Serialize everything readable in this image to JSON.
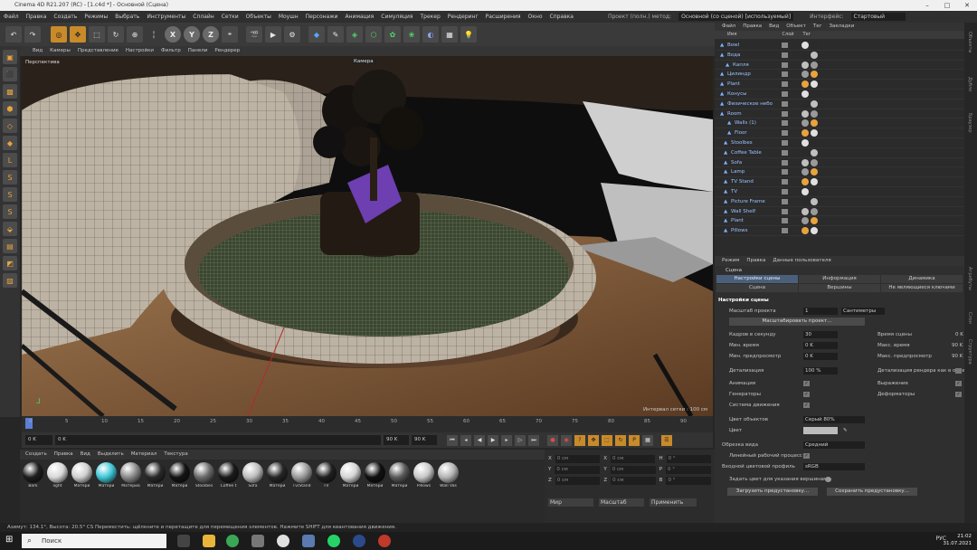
{
  "window": {
    "title": "Cinema 4D R21.207 (RC) - [1.c4d *] - Основной (Сцена)"
  },
  "menu": [
    "Файл",
    "Правка",
    "Создать",
    "Режимы",
    "Выбрать",
    "Инструменты",
    "Сплайн",
    "Сетки",
    "Объекты",
    "Моушн",
    "Персонажи",
    "Анимация",
    "Симуляция",
    "Трекер",
    "Рендеринг",
    "Расширения",
    "Окно",
    "Справка"
  ],
  "layout": {
    "label1": "Проект (полн.) метод:",
    "value1": "Основной (со сценой) [используемый]",
    "label2": "Интерфейс:",
    "value2": "Стартовый"
  },
  "toolbar_icons": [
    "undo-icon",
    "redo-icon",
    "live-select-icon",
    "move-icon",
    "scale-icon",
    "rotate-icon",
    "recent-icon",
    "x-axis-icon",
    "y-axis-icon",
    "z-axis-icon",
    "coord-system-icon",
    "render-view-icon",
    "render-picture-viewer-icon",
    "render-settings-icon",
    "cube-icon",
    "pen-icon",
    "subdivision-icon",
    "array-icon",
    "extrude-icon",
    "environment-icon",
    "deformer-icon",
    "camera-icon",
    "light-icon"
  ],
  "xyz": [
    "X",
    "Y",
    "Z"
  ],
  "viewport": {
    "menu": [
      "Вид",
      "Камеры",
      "Представление",
      "Настройки",
      "Фильтр",
      "Панели",
      "Рендерер"
    ],
    "view_name": "Перспектива",
    "camera": "Камера",
    "grid": "Интервал сетки : 100 см"
  },
  "timeline": {
    "ticks": [
      "0",
      "5",
      "10",
      "15",
      "20",
      "25",
      "30",
      "35",
      "40",
      "45",
      "50",
      "55",
      "60",
      "65",
      "70",
      "75",
      "80",
      "85",
      "90"
    ]
  },
  "playback": {
    "start": "0 K",
    "current": "0 K",
    "end": "90 K",
    "max": "90 K"
  },
  "materials": {
    "menu": [
      "Создать",
      "Правка",
      "Вид",
      "Выделить",
      "Материал",
      "Текстура"
    ],
    "items": [
      {
        "name": "Bark",
        "c": "#1e1e1e"
      },
      {
        "name": "light",
        "c": "#d8d8d8"
      },
      {
        "name": "Матери",
        "c": "#cfcfcf"
      },
      {
        "name": "Матери",
        "c": "#3ec6d6"
      },
      {
        "name": "Материа",
        "c": "#8a8a8a"
      },
      {
        "name": "Матери",
        "c": "#2a2a2a"
      },
      {
        "name": "Матери",
        "c": "#141414"
      },
      {
        "name": "Stoolbes",
        "c": "#6a6a6a"
      },
      {
        "name": "Coffee t",
        "c": "#1a1a1a"
      },
      {
        "name": "Sofa",
        "c": "#bdbdbd"
      },
      {
        "name": "Матери",
        "c": "#262626"
      },
      {
        "name": "Tv/Stand",
        "c": "#9a9a9a"
      },
      {
        "name": "TV",
        "c": "#202020"
      },
      {
        "name": "Матери",
        "c": "#d5d5d5"
      },
      {
        "name": "Матери",
        "c": "#101010"
      },
      {
        "name": "Матери",
        "c": "#5a5a5a"
      },
      {
        "name": "Pillows",
        "c": "#c8c8c8"
      },
      {
        "name": "Wall Vas",
        "c": "#b4b4b4"
      }
    ]
  },
  "coords": {
    "rows": [
      {
        "a": "X",
        "v1": "0 см",
        "b": "X",
        "v2": "0 см",
        "c": "H",
        "v3": "0 °"
      },
      {
        "a": "Y",
        "v1": "0 см",
        "b": "Y",
        "v2": "0 см",
        "c": "P",
        "v3": "0 °"
      },
      {
        "a": "Z",
        "v1": "0 см",
        "b": "Z",
        "v2": "0 см",
        "c": "B",
        "v3": "0 °"
      }
    ],
    "mode1": "Мир",
    "mode2": "Масштаб",
    "apply": "Применить"
  },
  "objects": {
    "menu": [
      "Файл",
      "Правка",
      "Вид",
      "Объект",
      "Тег",
      "Закладки"
    ],
    "header": [
      "Имя",
      "Слой",
      "Тег"
    ],
    "items": [
      {
        "name": "Bowl",
        "indent": 14
      },
      {
        "name": "Вода",
        "indent": 14
      },
      {
        "name": "Капля",
        "indent": 20
      },
      {
        "name": "Цилиндр",
        "indent": 14
      },
      {
        "name": "Plant",
        "indent": 14
      },
      {
        "name": "Конусы",
        "indent": 14
      },
      {
        "name": "Физическое небо",
        "indent": 14
      },
      {
        "name": "Room",
        "indent": 14
      },
      {
        "name": "Walls (1)",
        "indent": 22
      },
      {
        "name": "Floor",
        "indent": 22
      },
      {
        "name": "Stoolbes",
        "indent": 18
      },
      {
        "name": "Coffee Table",
        "indent": 18
      },
      {
        "name": "Sofa",
        "indent": 18
      },
      {
        "name": "Lamp",
        "indent": 18
      },
      {
        "name": "TV Stand",
        "indent": 18
      },
      {
        "name": "TV",
        "indent": 18
      },
      {
        "name": "Picture Frame",
        "indent": 18
      },
      {
        "name": "Wall Shelf",
        "indent": 18
      },
      {
        "name": "Plant",
        "indent": 18
      },
      {
        "name": "Pillows",
        "indent": 18
      }
    ]
  },
  "attributes": {
    "menu": [
      "Режим",
      "Правка",
      "Данные пользователя"
    ],
    "title": "Сцена",
    "tabs1": [
      "Настройки сцены",
      "Информация",
      "Динамика"
    ],
    "tabs2": [
      "Сцена",
      "Вершины",
      "Не являющиеся ключами"
    ],
    "section": "Настройки сцены",
    "scale_label": "Масштаб проекта",
    "scale_value": "1",
    "scale_unit": "Сантиметры",
    "scale_btn": "Масштабировать проект...",
    "fps_label": "Кадров в секунду",
    "fps_value": "30",
    "time_label": "Время сцены",
    "time_value": "0 K",
    "min_label": "Мин. время",
    "min_value": "0 K",
    "max_label": "Макс. время",
    "max_value": "90 K",
    "pmin_label": "Мин. предпросмотр",
    "pmin_value": "0 K",
    "pmax_label": "Макс. предпросмотр",
    "pmax_value": "90 K",
    "lod_label": "Детализация",
    "lod_value": "100 %",
    "lod2_label": "Детализация рендера как в окне",
    "anim_label": "Анимация",
    "expr_label": "Выражение",
    "gen_label": "Генераторы",
    "def_label": "Деформаторы",
    "mot_label": "Система движения",
    "color_label": "Цвет объектов",
    "color_value": "Серый 80%",
    "view_label": "Цвет",
    "clip_label": "Обрезка вида",
    "clip_value": "Средний",
    "linear_label": "Линейный рабочий процесс",
    "profile_label": "Входной цветовой профиль",
    "profile_value": "sRGB",
    "vert_label": "Задать цвет для указания вершинами",
    "btn1": "Загрузить предустановку...",
    "btn2": "Сохранить предустановку..."
  },
  "status": "Азимут: 134.1°, Высота: 20.5°  CS   Переместить: щёлкните и перетащите для перемещения элементов. Нажмите SHIFT для квантования движения.",
  "taskbar": {
    "search": "Поиск",
    "lang": "РУС",
    "time": "21:02",
    "date": "31.07.2021"
  },
  "colors": {
    "accent": "#c98a2a",
    "select": "#4a5f7a"
  }
}
